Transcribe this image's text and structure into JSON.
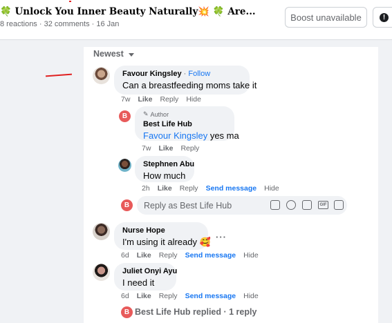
{
  "header": {
    "title_lead_icon": "🍀",
    "title_text": "Unlock You Inner Beauty Naturally",
    "title_spark_icon": "💥",
    "title_trail_icon": "🍀",
    "title_suffix": "Are...",
    "meta": "8 reactions · 32 comments · 16 Jan",
    "boost_label": "Boost unavailable",
    "more_icon": "!"
  },
  "comments_sort": {
    "label": "Newest"
  },
  "comments": [
    {
      "author": "Favour Kingsley",
      "follow_sep": " · ",
      "follow_label": "Follow",
      "text": "Can a breastfeeding moms take it",
      "time": "7w",
      "like": "Like",
      "reply": "Reply",
      "hide": "Hide"
    },
    {
      "badge": "Author",
      "author": "Best Life Hub",
      "mention": "Favour Kingsley",
      "text": " yes ma",
      "time": "7w",
      "like": "Like",
      "reply": "Reply",
      "avatar_letter": "B"
    },
    {
      "author": "Stephnen Abu",
      "text": "How much",
      "time": "2h",
      "like": "Like",
      "reply": "Reply",
      "send_message": "Send message",
      "hide": "Hide"
    },
    {
      "author": "Nurse Hope",
      "text": "I'm using it already 🥰",
      "time": "6d",
      "like": "Like",
      "reply": "Reply",
      "send_message": "Send message",
      "hide": "Hide",
      "more": "···"
    },
    {
      "author": "Juliet Onyi Ayu",
      "text": "I need it",
      "time": "6d",
      "like": "Like",
      "reply": "Reply",
      "send_message": "Send message",
      "hide": "Hide"
    }
  ],
  "reply_box": {
    "avatar_letter": "B",
    "placeholder": "Reply as Best Life Hub"
  },
  "replied_summary": {
    "avatar_letter": "B",
    "text": "Best Life Hub replied · 1 reply"
  },
  "colors": {
    "link": "#1877f2",
    "muted": "#65676b",
    "bubble": "#f0f2f5",
    "annotation": "#e02020",
    "avatar_b": "#e85a5a"
  }
}
